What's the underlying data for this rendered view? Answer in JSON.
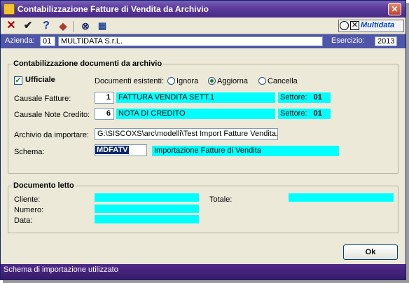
{
  "window": {
    "title": "Contabilizzazione Fatture di Vendita da Archivio"
  },
  "toolbar": {
    "brand": "Multidata"
  },
  "azienda": {
    "label": "Azienda:",
    "code": "01",
    "name": "MULTIDATA S.r.L.",
    "esercizio_label": "Esercizio:",
    "esercizio": "2013"
  },
  "group_main": {
    "title": "Contabilizzazione documenti da archivio",
    "ufficiale_label": "Ufficiale",
    "ufficiale_checked": true,
    "documenti_label": "Documenti esistenti:",
    "radios": [
      {
        "label": "Ignora",
        "selected": false
      },
      {
        "label": "Aggiorna",
        "selected": true
      },
      {
        "label": "Cancella",
        "selected": false
      }
    ],
    "causale_fatture": {
      "label": "Causale Fatture:",
      "code": "1",
      "desc": "FATTURA VENDITA SETT.1",
      "settore_label": "Settore:",
      "settore": "01"
    },
    "causale_nc": {
      "label": "Causale Note Credito:",
      "code": "6",
      "desc": "NOTA DI CREDITO",
      "settore_label": "Settore:",
      "settore": "01"
    },
    "archivio": {
      "label": "Archivio da importare:",
      "value": "G:\\SISCOXS\\arc\\modelli\\Test Import Fatture Vendita.csv"
    },
    "schema": {
      "label": "Schema:",
      "code": "MDFATV",
      "desc": "Importazione Fatture di Vendita"
    }
  },
  "group_letto": {
    "title": "Documento letto",
    "cliente_label": "Cliente:",
    "numero_label": "Numero:",
    "data_label": "Data:",
    "totale_label": "Totale:"
  },
  "ok_label": "Ok",
  "status": "Schema di importazione utilizzato",
  "colors": {
    "titlebar": "#5a3a9a",
    "azbar": "#4f55a8",
    "cyan": "#00ffff",
    "status": "#4f2a88"
  }
}
